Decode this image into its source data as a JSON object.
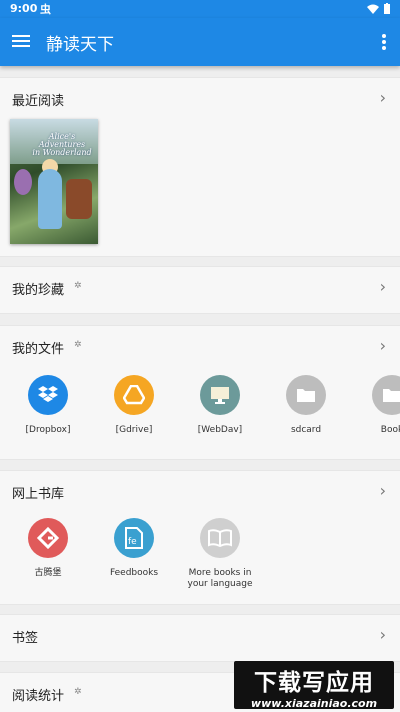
{
  "status": {
    "time": "9:00",
    "notif_icon": "虫"
  },
  "app": {
    "title": "静读天下"
  },
  "recent": {
    "title": "最近阅读",
    "book": {
      "cover_title_1": "Alice's",
      "cover_title_2": "Adventures",
      "cover_title_3": "in Wonderland"
    }
  },
  "favorites": {
    "title": "我的珍藏"
  },
  "files": {
    "title": "我的文件",
    "items": [
      {
        "label": "[Dropbox]",
        "color": "#1e88e5",
        "icon": "dropbox-icon"
      },
      {
        "label": "[Gdrive]",
        "color": "#f5a623",
        "icon": "gdrive-icon"
      },
      {
        "label": "[WebDav]",
        "color": "#6c9a9a",
        "icon": "webdav-icon"
      },
      {
        "label": "sdcard",
        "color": "#bdbdbd",
        "icon": "folder-icon"
      },
      {
        "label": "Book",
        "color": "#bdbdbd",
        "icon": "folder-icon"
      }
    ]
  },
  "online": {
    "title": "网上书库",
    "items": [
      {
        "label": "古腾堡",
        "color": "#e05a5a",
        "icon": "gutenberg-icon"
      },
      {
        "label": "Feedbooks",
        "color": "#3aa0d0",
        "icon": "feedbooks-icon"
      },
      {
        "label": "More books in your language",
        "color": "#cfcfcf",
        "icon": "open-book-icon"
      }
    ]
  },
  "bookmarks": {
    "title": "书签"
  },
  "stats": {
    "title": "阅读统计"
  },
  "watermark": {
    "line1": "下载写应用",
    "line2": "www.xiazainiao.com"
  }
}
